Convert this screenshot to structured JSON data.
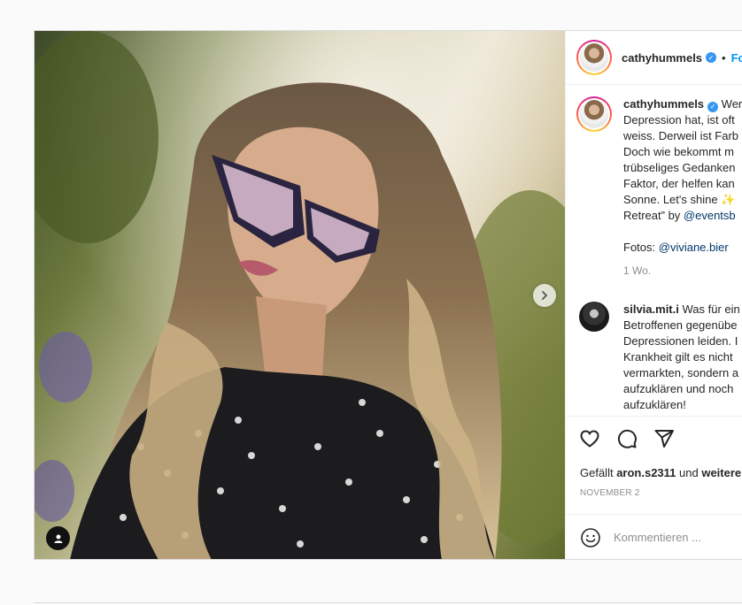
{
  "post": {
    "username": "cathyhummels",
    "follow_label": "Fo",
    "separator": "•"
  },
  "caption": {
    "username": "cathyhummels",
    "lines": [
      "Wer",
      "Depression hat, ist oft",
      "weiss. Derweil ist Farb",
      "Doch wie bekommt m",
      "trübseliges Gedanken",
      "Faktor, der helfen kan",
      "Sonne. Let's shine ✨",
      "Retreat” by "
    ],
    "mention_events": "@eventsb",
    "photo_credit_prefix": "Fotos: ",
    "photo_credit_mention": "@viviane.bier",
    "time": "1 Wo."
  },
  "comment": {
    "username": "silvia.mit.i",
    "lines": [
      "Was für ein",
      "Betroffenen gegenübe",
      "Depressionen leiden. I",
      "Krankheit gilt es nicht",
      "vermarkten, sondern a",
      "aufzuklären und noch",
      "aufzuklären!"
    ]
  },
  "actions": {
    "likes_prefix": "Gefällt ",
    "likes_user": "aron.s2311",
    "likes_mid": " und ",
    "likes_more": "weitere",
    "date": "NOVEMBER 2"
  },
  "add_comment": {
    "placeholder": "Kommentieren ..."
  },
  "colors": {
    "link": "#00376b",
    "follow": "#0095f6",
    "verified": "#3897f0"
  }
}
